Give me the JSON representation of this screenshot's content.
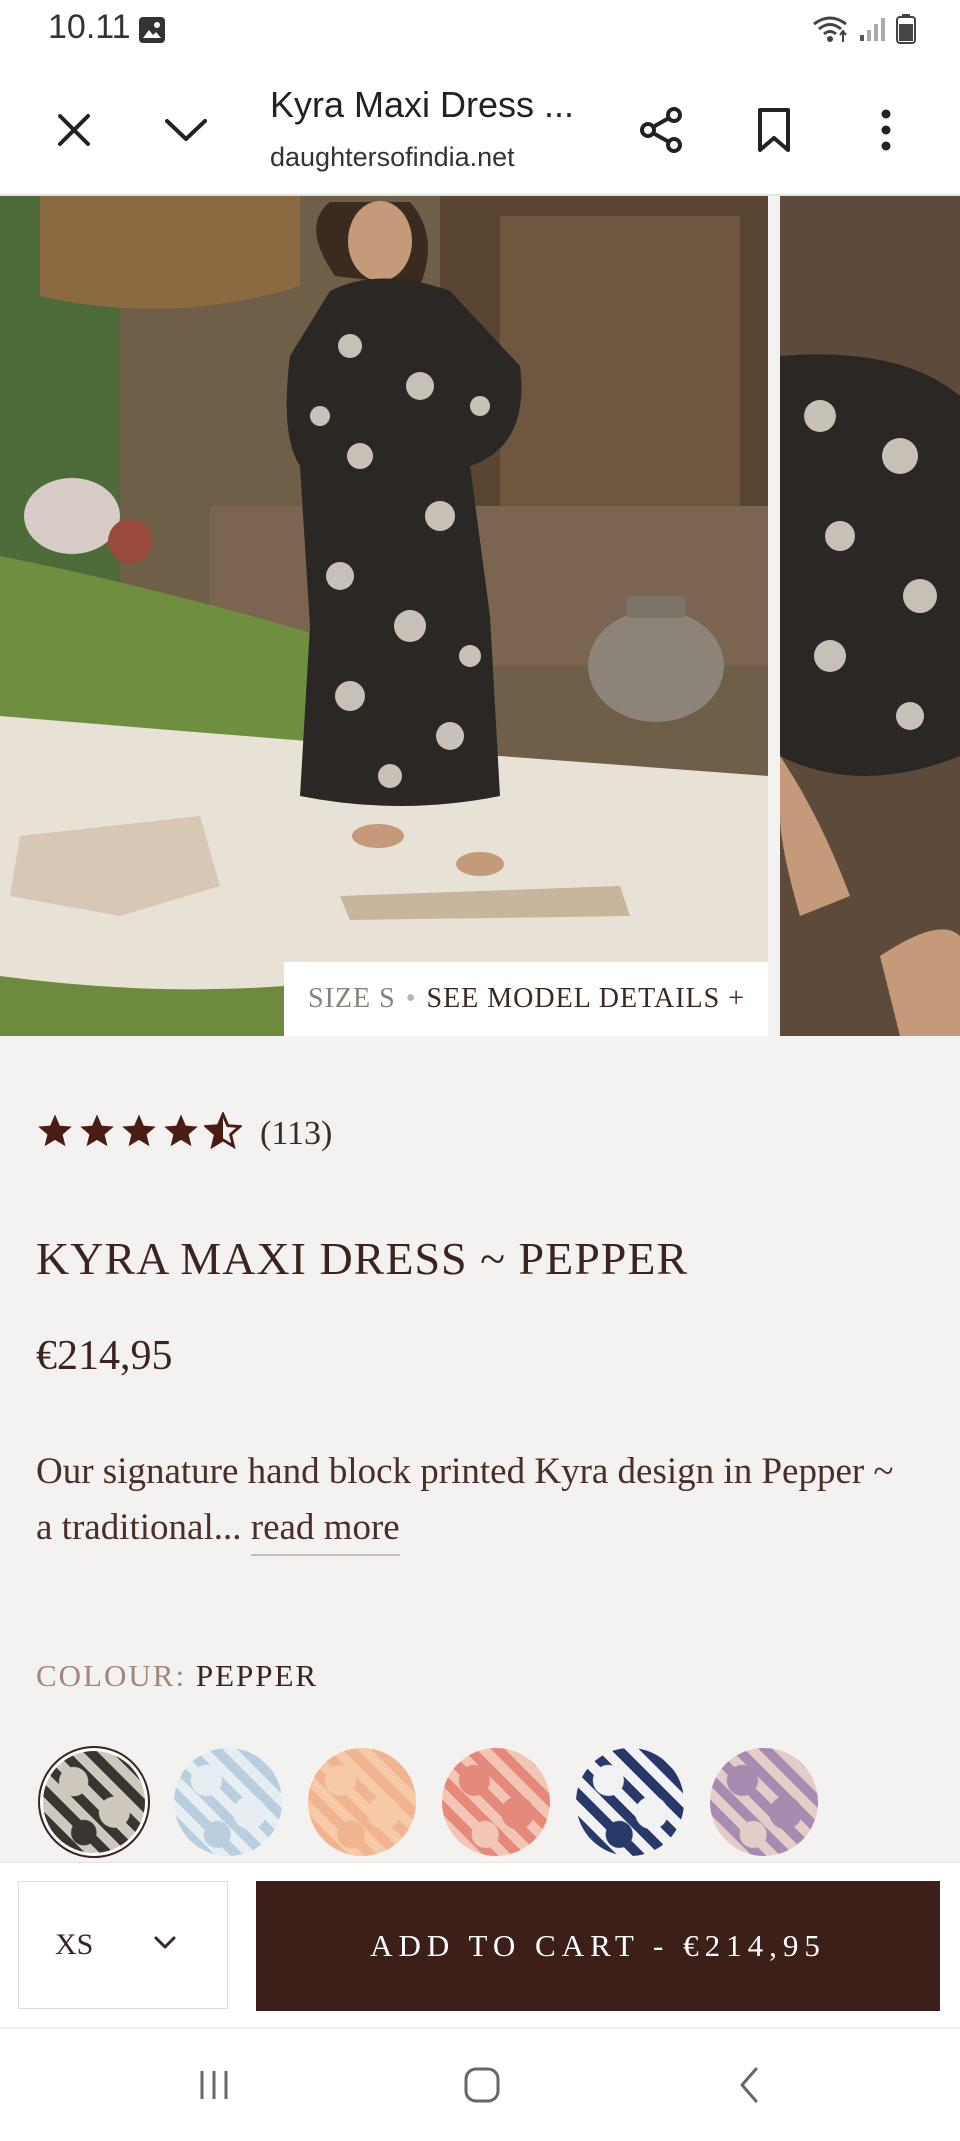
{
  "status_bar": {
    "time": "10.11",
    "icons": [
      "gallery-icon",
      "wifi-icon",
      "signal-icon",
      "battery-icon"
    ]
  },
  "browser": {
    "page_title": "Kyra Maxi Dress ...",
    "url": "daughtersofindia.net",
    "icons": [
      "close-icon",
      "chevron-down-icon",
      "share-icon",
      "bookmark-icon",
      "more-vert-icon"
    ]
  },
  "gallery": {
    "size_tag": {
      "size": "SIZE S",
      "separator": "•",
      "link": "SEE MODEL DETAILS +"
    }
  },
  "product": {
    "rating_value": 4.5,
    "rating_max": 5,
    "rating_count": "(113)",
    "title": "KYRA MAXI DRESS ~ PEPPER",
    "price": "€214,95",
    "description": "Our signature hand block printed Kyra design in Pepper ~ a traditional...",
    "read_more": "read more",
    "colour_label": "COLOUR:",
    "colour_value": "PEPPER"
  },
  "swatches": [
    {
      "colors": [
        "#3a3530",
        "#cfc8bc"
      ],
      "selected": true
    },
    {
      "colors": [
        "#b9cfe0",
        "#e6eef2"
      ],
      "selected": false
    },
    {
      "colors": [
        "#f0b48e",
        "#f6c9a8"
      ],
      "selected": false
    },
    {
      "colors": [
        "#f2c5b6",
        "#e58a7a"
      ],
      "selected": false
    },
    {
      "colors": [
        "#27386b",
        "#f2f2f4"
      ],
      "selected": false
    },
    {
      "colors": [
        "#e4ccc8",
        "#a98ab0"
      ],
      "selected": false
    }
  ],
  "cart_bar": {
    "size_value": "XS",
    "add_to_cart": "ADD TO CART - €214,95"
  },
  "colors": {
    "accent": "#3b1f18",
    "star": "#4a1d14",
    "text_brown": "#3b2420",
    "background": "#f4f2f0"
  },
  "nav_bar": {
    "icons": [
      "recent-apps-icon",
      "home-icon",
      "back-icon"
    ]
  }
}
